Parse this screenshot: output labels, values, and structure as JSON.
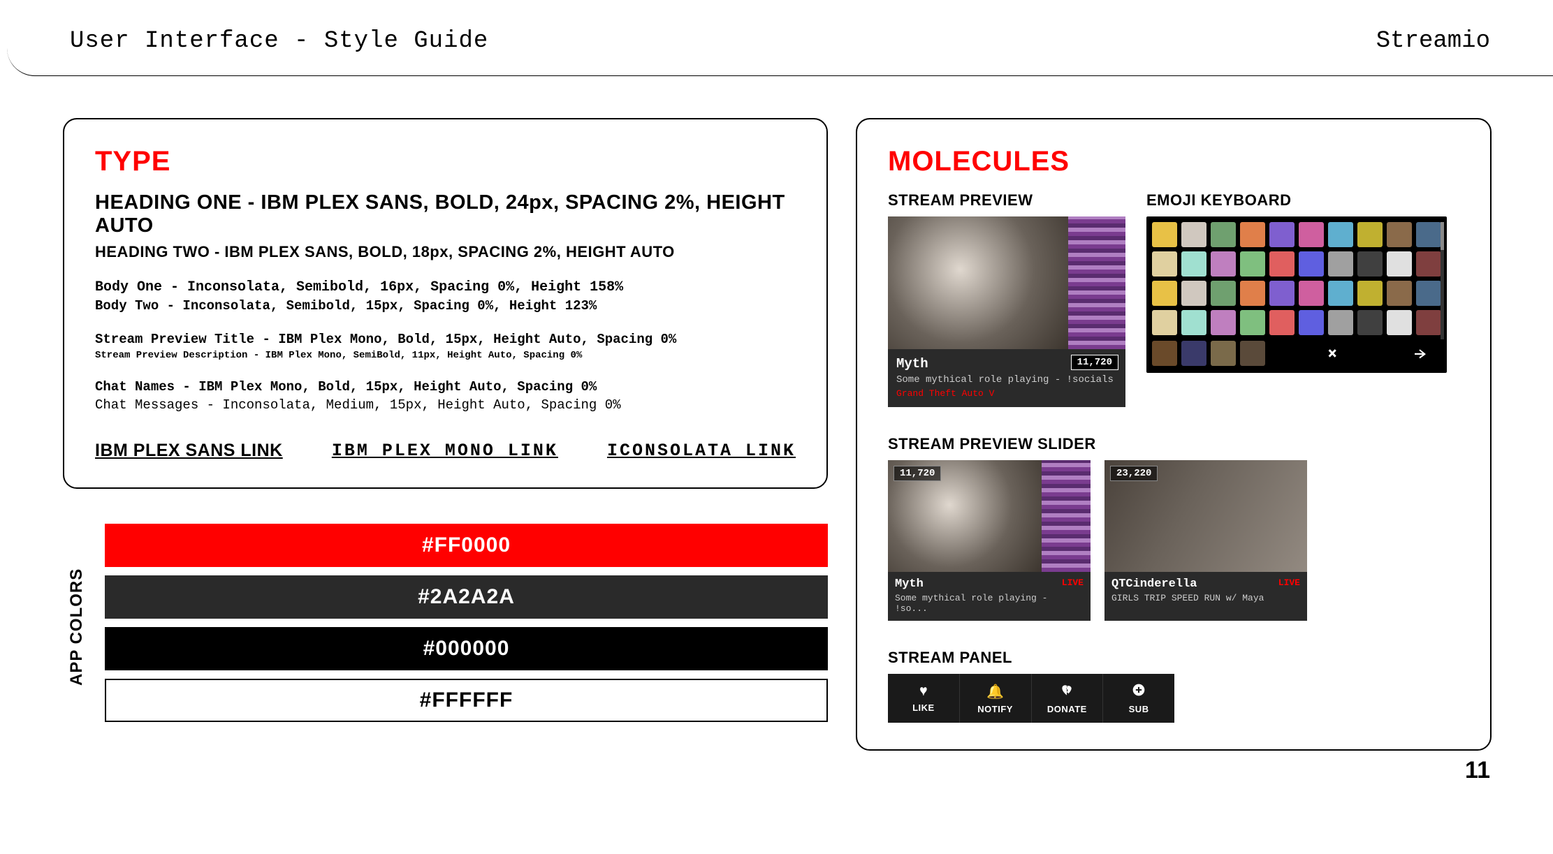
{
  "header": {
    "title": "User Interface - Style Guide",
    "brand": "Streamio"
  },
  "type": {
    "section_title": "TYPE",
    "h1": "HEADING ONE - IBM PLEX SANS, BOLD, 24px, SPACING 2%, HEIGHT AUTO",
    "h2": "HEADING TWO - IBM PLEX SANS, BOLD, 18px, SPACING 2%, HEIGHT AUTO",
    "body1": "Body One - Inconsolata, Semibold, 16px, Spacing 0%, Height 158%",
    "body2": "Body Two - Inconsolata, Semibold, 15px, Spacing 0%, Height 123%",
    "preview_title": "Stream Preview Title - IBM Plex Mono, Bold, 15px, Height Auto, Spacing 0%",
    "preview_desc": "Stream Preview Description - IBM Plex Mono, SemiBold, 11px, Height Auto, Spacing 0%",
    "chat_names": "Chat Names - IBM Plex Mono, Bold, 15px, Height Auto, Spacing 0%",
    "chat_messages": "Chat Messages - Inconsolata, Medium, 15px, Height Auto, Spacing 0%",
    "links": {
      "sans": "IBM PLEX SANS LINK",
      "mono": "IBM PLEX MONO LINK",
      "inconsolata": "ICONSOLATA LINK"
    }
  },
  "colors": {
    "label": "APP COLORS",
    "items": [
      {
        "hex": "#FF0000"
      },
      {
        "hex": "#2A2A2A"
      },
      {
        "hex": "#000000"
      },
      {
        "hex": "#FFFFFF"
      }
    ]
  },
  "molecules": {
    "section_title": "MOLECULES",
    "preview_label": "STREAM PREVIEW",
    "emoji_label": "EMOJI KEYBOARD",
    "slider_label": "STREAM PREVIEW SLIDER",
    "panel_label": "STREAM PANEL",
    "preview_card": {
      "title": "Myth",
      "desc": "Some mythical role playing - !socials",
      "game": "Grand Theft Auto V",
      "viewers": "11,720"
    },
    "slider": [
      {
        "title": "Myth",
        "desc": "Some mythical role playing - !so...",
        "count": "11,720",
        "live": "LIVE"
      },
      {
        "title": "QTCinderella",
        "desc": "GIRLS TRIP SPEED RUN w/ Maya",
        "count": "23,220",
        "live": "LIVE"
      }
    ],
    "panel_actions": [
      {
        "label": "LIKE",
        "icon": "heart-icon"
      },
      {
        "label": "NOTIFY",
        "icon": "bell-icon"
      },
      {
        "label": "DONATE",
        "icon": "broken-heart-icon"
      },
      {
        "label": "SUB",
        "icon": "plus-circle-icon"
      }
    ]
  },
  "page_number": "11"
}
